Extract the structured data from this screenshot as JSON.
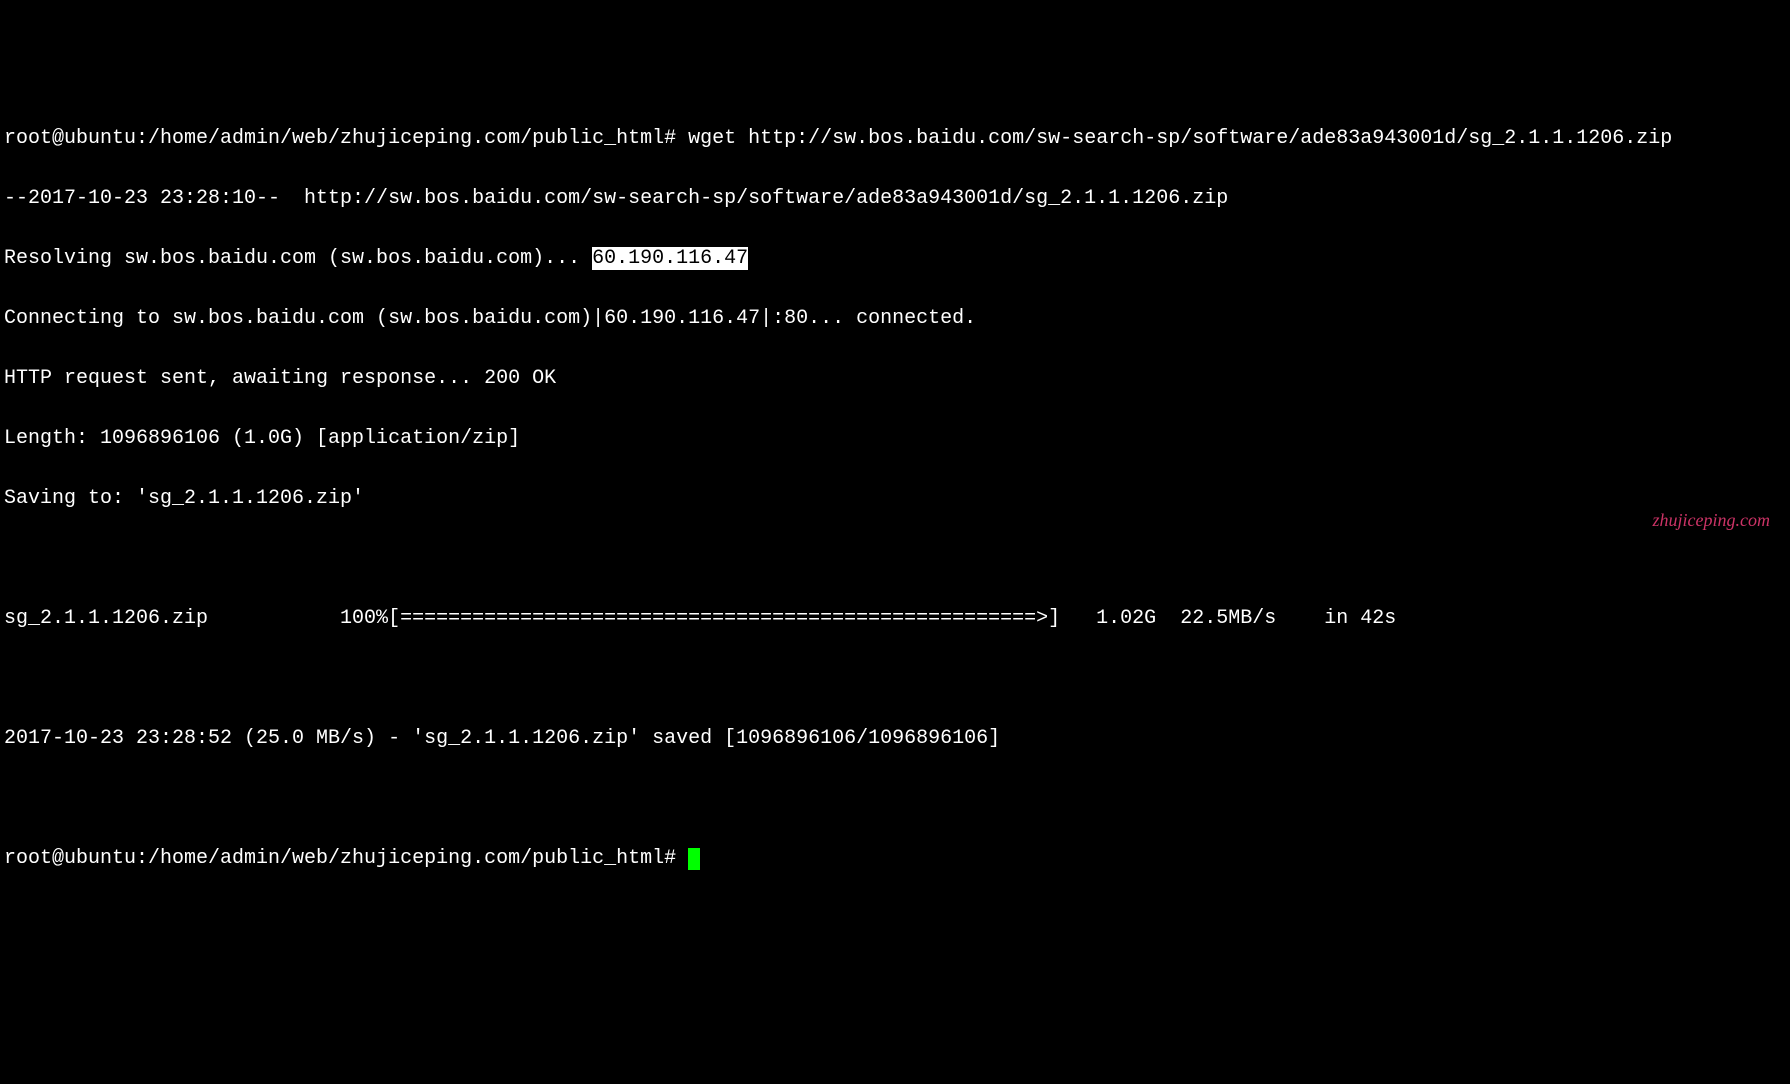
{
  "terminal": {
    "prompt1": "root@ubuntu:/home/admin/web/zhujiceping.com/public_html# ",
    "command": "wget http://sw.bos.baidu.com/sw-search-sp/software/ade83a943001d/sg_2.1.1.1206.zip",
    "line_timestamp": "--2017-10-23 23:28:10--  http://sw.bos.baidu.com/sw-search-sp/software/ade83a943001d/sg_2.1.1.1206.zip",
    "line_resolving_pre": "Resolving sw.bos.baidu.com (sw.bos.baidu.com)... ",
    "line_resolving_ip": "60.190.116.47",
    "line_connecting": "Connecting to sw.bos.baidu.com (sw.bos.baidu.com)|60.190.116.47|:80... connected.",
    "line_http": "HTTP request sent, awaiting response... 200 OK",
    "line_length": "Length: 1096896106 (1.0G) [application/zip]",
    "line_saving": "Saving to: 'sg_2.1.1.1206.zip'",
    "line_progress": "sg_2.1.1.1206.zip           100%[=====================================================>]   1.02G  22.5MB/s    in 42s",
    "line_summary": "2017-10-23 23:28:52 (25.0 MB/s) - 'sg_2.1.1.1206.zip' saved [1096896106/1096896106]",
    "prompt2": "root@ubuntu:/home/admin/web/zhujiceping.com/public_html# "
  },
  "watermark": "zhujiceping.com"
}
